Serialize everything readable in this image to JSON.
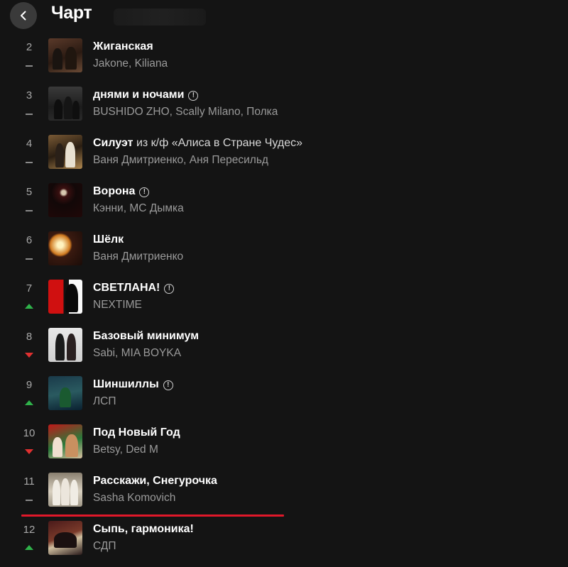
{
  "header": {
    "title": "Чарт"
  },
  "tracks": [
    {
      "pos": "2",
      "trend": "same",
      "cover": "c2",
      "title": "Жиганская",
      "subtitle": "",
      "explicit": false,
      "artists": "Jakone, Kiliana"
    },
    {
      "pos": "3",
      "trend": "same",
      "cover": "c3",
      "title": "днями и ночами",
      "subtitle": "",
      "explicit": true,
      "artists": "BUSHIDO ZHO, Scally Milano, Полка"
    },
    {
      "pos": "4",
      "trend": "same",
      "cover": "c4",
      "title": "Силуэт",
      "subtitle": "из к/ф «Алиса в Стране Чудес»",
      "explicit": false,
      "artists": "Ваня Дмитриенко, Аня Пересильд"
    },
    {
      "pos": "5",
      "trend": "same",
      "cover": "c5",
      "title": "Ворона",
      "subtitle": "",
      "explicit": true,
      "artists": "Кэнни, MC Дымка"
    },
    {
      "pos": "6",
      "trend": "same",
      "cover": "c6",
      "title": "Шёлк",
      "subtitle": "",
      "explicit": false,
      "artists": "Ваня Дмитриенко"
    },
    {
      "pos": "7",
      "trend": "up",
      "cover": "c7",
      "title": "СВЕТЛАНА!",
      "subtitle": "",
      "explicit": true,
      "artists": "NEXTIME"
    },
    {
      "pos": "8",
      "trend": "down",
      "cover": "c8",
      "title": "Базовый минимум",
      "subtitle": "",
      "explicit": false,
      "artists": "Sabi, MIA BOYKA"
    },
    {
      "pos": "9",
      "trend": "up",
      "cover": "c9",
      "title": "Шиншиллы",
      "subtitle": "",
      "explicit": true,
      "artists": "ЛСП"
    },
    {
      "pos": "10",
      "trend": "down",
      "cover": "c10",
      "title": "Под Новый Год",
      "subtitle": "",
      "explicit": false,
      "artists": "Betsy, Ded M"
    },
    {
      "pos": "11",
      "trend": "same",
      "cover": "c11",
      "title": "Расскажи, Снегурочка",
      "subtitle": "",
      "explicit": false,
      "artists": "Sasha Komovich"
    },
    {
      "pos": "12",
      "trend": "up",
      "cover": "c12",
      "title": "Сыпь, гармоника!",
      "subtitle": "",
      "explicit": false,
      "artists": "СДП"
    }
  ],
  "explicit_mark": "!",
  "colors": {
    "background": "#141414",
    "up": "#2fb24a",
    "down": "#e03030",
    "divider": "#e0182a"
  }
}
